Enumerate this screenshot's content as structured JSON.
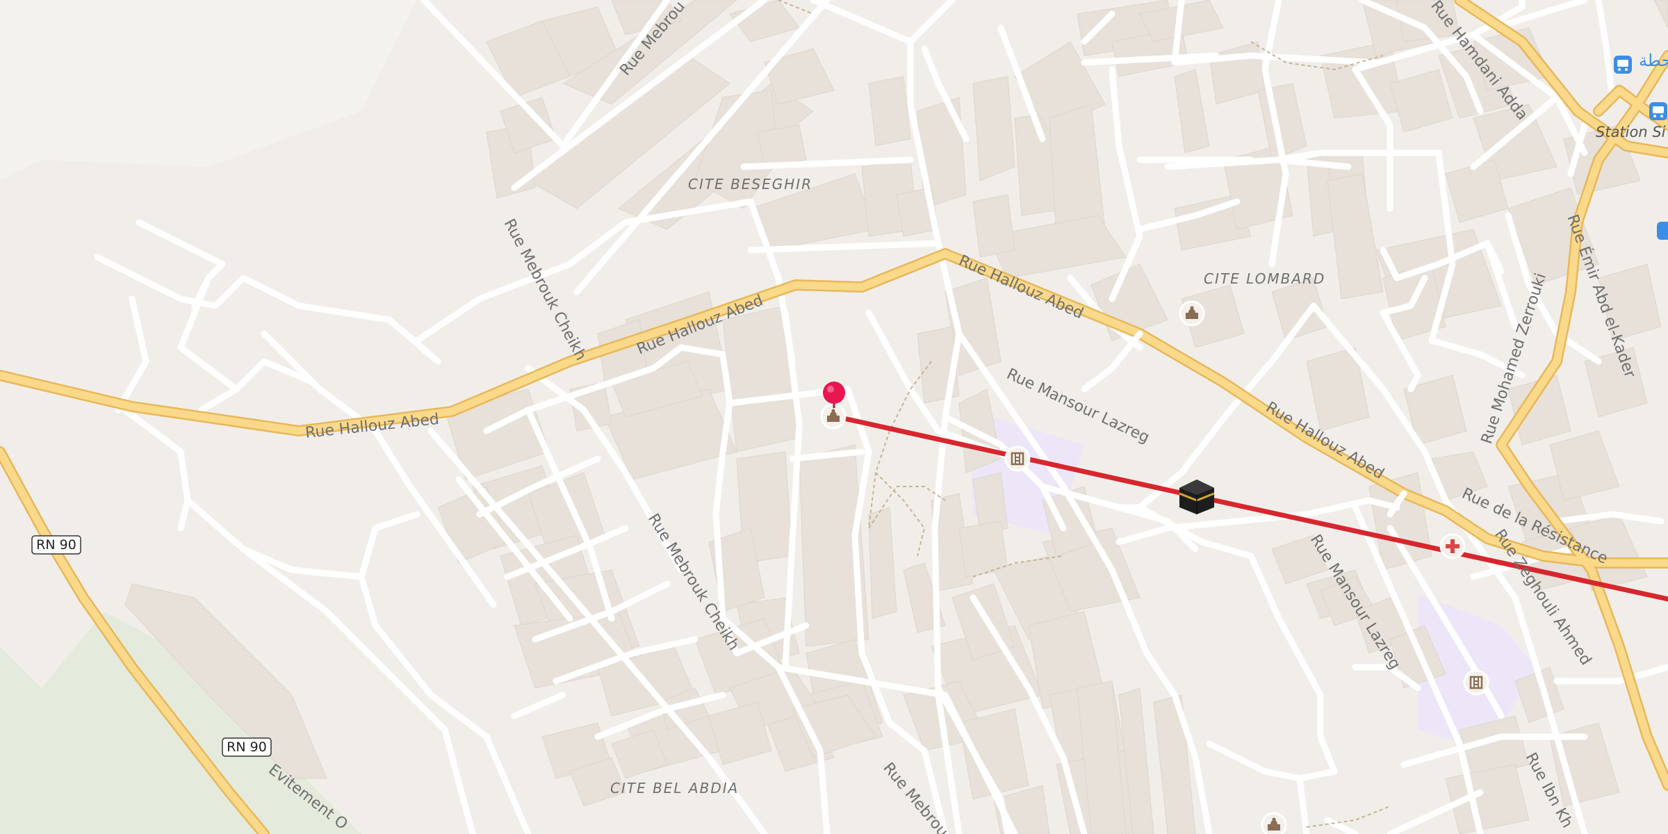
{
  "colors": {
    "background": "#f1eeea",
    "building": "#e7e1da",
    "road": "#ffffff",
    "main_road": "#fbd98a",
    "main_road_casing": "#e8b75a",
    "school_area": "#ece6f8",
    "vegetation": "#e4ebdc",
    "route_line": "#d7262e",
    "pin": "#e8174f",
    "transit": "#3b8ee8"
  },
  "streets": {
    "hallouz_w": "Rue Hallouz Abed",
    "hallouz_mid": "Rue Hallouz Abed",
    "hallouz_e1": "Rue Hallouz Abed",
    "hallouz_e2": "Rue Hallouz Abed",
    "mebrouk_top": "Rue Mebrou",
    "mebrouk_cheikh1": "Rue Mebrouk Cheikh",
    "mebrouk_cheikh2": "Rue Mebrouk Cheikh",
    "mebrouk_bottom": "Rue Mebrou",
    "mansour1": "Rue Mansour Lazreg",
    "mansour2": "Rue Mansour Lazreg",
    "hamdani": "Rue Hamdani Adda",
    "zerrouki": "Rue Mohamed Zerrouki",
    "emir": "Rue Émir Abd el-Kader",
    "resistance": "Rue de la Résistance",
    "zeghouli": "Rue Zeghouli Ahmed",
    "ibn": "Rue Ibn Kh",
    "evitement": "Evitement O"
  },
  "districts": {
    "beseghir": "CITE BESEGHIR",
    "lombard": "CITE LOMBARD",
    "bel_abdia": "CITE BEL ABDIA"
  },
  "shields": {
    "rn90_a": "RN 90",
    "rn90_b": "RN 90"
  },
  "transit": {
    "station_label": "Station Si",
    "arabic_label": "محطة"
  },
  "icons": {
    "pin": "location-pin-icon",
    "kaaba": "kaaba-icon",
    "mosque": "mosque-icon",
    "school": "school-icon",
    "hospital": "hospital-cross-icon",
    "bus": "bus-stop-icon"
  }
}
